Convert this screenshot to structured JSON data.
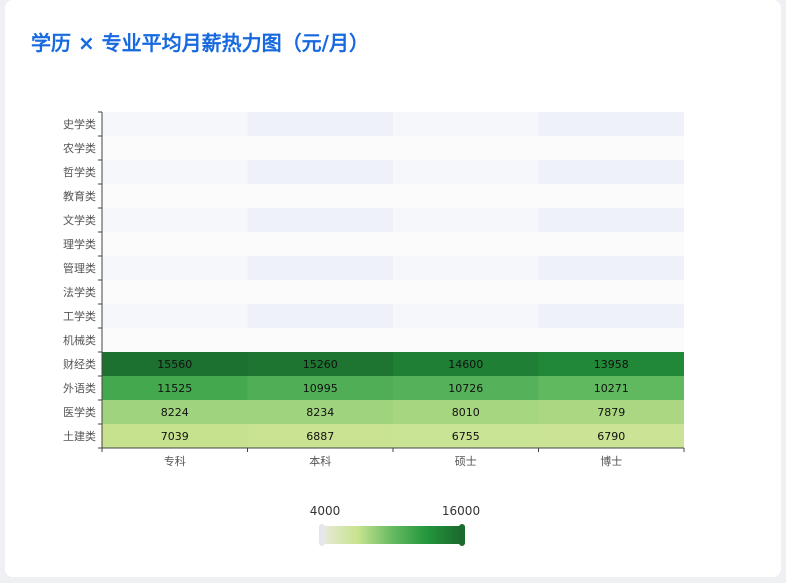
{
  "title": "学历 × 专业平均月薪热力图（元/月）",
  "chart_data": {
    "type": "heatmap",
    "x_categories": [
      "专科",
      "本科",
      "硕士",
      "博士"
    ],
    "y_categories": [
      "史学类",
      "农学类",
      "哲学类",
      "教育类",
      "文学类",
      "理学类",
      "管理类",
      "法学类",
      "工学类",
      "机械类",
      "财经类",
      "外语类",
      "医学类",
      "土建类"
    ],
    "cells": [
      {
        "x": "专科",
        "y": "财经类",
        "value": 15560
      },
      {
        "x": "本科",
        "y": "财经类",
        "value": 15260
      },
      {
        "x": "硕士",
        "y": "财经类",
        "value": 14600
      },
      {
        "x": "博士",
        "y": "财经类",
        "value": 13958
      },
      {
        "x": "专科",
        "y": "外语类",
        "value": 11525
      },
      {
        "x": "本科",
        "y": "外语类",
        "value": 10995
      },
      {
        "x": "硕士",
        "y": "外语类",
        "value": 10726
      },
      {
        "x": "博士",
        "y": "外语类",
        "value": 10271
      },
      {
        "x": "专科",
        "y": "医学类",
        "value": 8224
      },
      {
        "x": "本科",
        "y": "医学类",
        "value": 8234
      },
      {
        "x": "硕士",
        "y": "医学类",
        "value": 8010
      },
      {
        "x": "博士",
        "y": "医学类",
        "value": 7879
      },
      {
        "x": "专科",
        "y": "土建类",
        "value": 7039
      },
      {
        "x": "本科",
        "y": "土建类",
        "value": 6887
      },
      {
        "x": "硕士",
        "y": "土建类",
        "value": 6755
      },
      {
        "x": "博士",
        "y": "土建类",
        "value": 6790
      }
    ],
    "visual_map": {
      "min": 4000,
      "max": 16000,
      "min_label": "4000",
      "max_label": "16000"
    },
    "colors": {
      "scale": [
        "#e6ead8",
        "#c8e38f",
        "#66bb63",
        "#24963c",
        "#1b6a2e"
      ],
      "empty_a": "#f6f7fb",
      "empty_b": "#eef1f9",
      "empty_c": "#fbfbfc",
      "title": "#1769e0"
    }
  }
}
